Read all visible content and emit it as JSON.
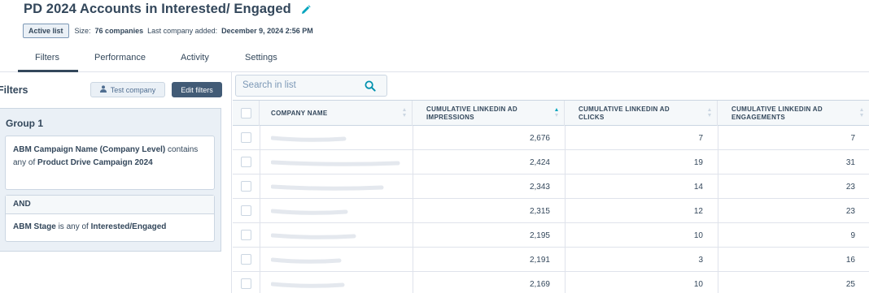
{
  "header": {
    "title": "PD 2024 Accounts in Interested/ Engaged",
    "edit_icon": "pencil-icon",
    "badge": "Active list",
    "size_label": "Size:",
    "size_value": "76 companies",
    "last_added_label": "Last company added:",
    "last_added_value": "December 9, 2024 2:56 PM"
  },
  "tabs": [
    {
      "label": "Filters",
      "active": true
    },
    {
      "label": "Performance",
      "active": false
    },
    {
      "label": "Activity",
      "active": false
    },
    {
      "label": "Settings",
      "active": false
    }
  ],
  "filters_panel": {
    "heading": "Filters",
    "test_company_label": "Test company",
    "edit_filters_label": "Edit filters",
    "group_title": "Group 1",
    "condition1": {
      "property": "ABM Campaign Name (Company Level)",
      "operator": "contains any of",
      "value": "Product Drive Campaign 2024"
    },
    "and_label": "AND",
    "condition2": {
      "property": "ABM Stage",
      "operator": "is any of",
      "value": "Interested/Engaged"
    }
  },
  "search": {
    "placeholder": "Search in list"
  },
  "table": {
    "columns": [
      "COMPANY NAME",
      "CUMULATIVE LINKEDIN AD IMPRESSIONS",
      "CUMULATIVE LINKEDIN AD CLICKS",
      "CUMULATIVE LINKEDIN AD ENGAGEMENTS"
    ],
    "sorted_column": "CUMULATIVE LINKEDIN AD IMPRESSIONS",
    "rows": [
      {
        "impressions": "2,676",
        "clicks": "7",
        "engagements": "7"
      },
      {
        "impressions": "2,424",
        "clicks": "19",
        "engagements": "31"
      },
      {
        "impressions": "2,343",
        "clicks": "14",
        "engagements": "23"
      },
      {
        "impressions": "2,315",
        "clicks": "12",
        "engagements": "23"
      },
      {
        "impressions": "2,195",
        "clicks": "10",
        "engagements": "9"
      },
      {
        "impressions": "2,191",
        "clicks": "3",
        "engagements": "16"
      },
      {
        "impressions": "2,169",
        "clicks": "10",
        "engagements": "25"
      }
    ]
  },
  "colors": {
    "text": "#33475b",
    "border": "#cbd6e2",
    "panel_bg": "#eaf0f6",
    "primary_button": "#425b76",
    "accent": "#00a4bd"
  }
}
